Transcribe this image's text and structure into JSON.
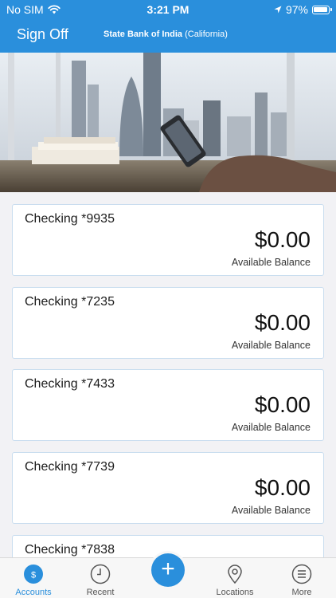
{
  "status_bar": {
    "carrier": "No SIM",
    "time": "3:21 PM",
    "battery": "97%"
  },
  "nav": {
    "sign_off": "Sign Off",
    "bank_name": "State Bank of India",
    "bank_region": "(California)"
  },
  "accounts": [
    {
      "name": "Checking *9935",
      "balance": "$0.00",
      "balance_label": "Available Balance"
    },
    {
      "name": "Checking *7235",
      "balance": "$0.00",
      "balance_label": "Available Balance"
    },
    {
      "name": "Checking *7433",
      "balance": "$0.00",
      "balance_label": "Available Balance"
    },
    {
      "name": "Checking *7739",
      "balance": "$0.00",
      "balance_label": "Available Balance"
    },
    {
      "name": "Checking *7838"
    }
  ],
  "tabbar": {
    "accounts": "Accounts",
    "recent": "Recent",
    "locations": "Locations",
    "more": "More"
  },
  "colors": {
    "brand": "#2a8fdc"
  }
}
